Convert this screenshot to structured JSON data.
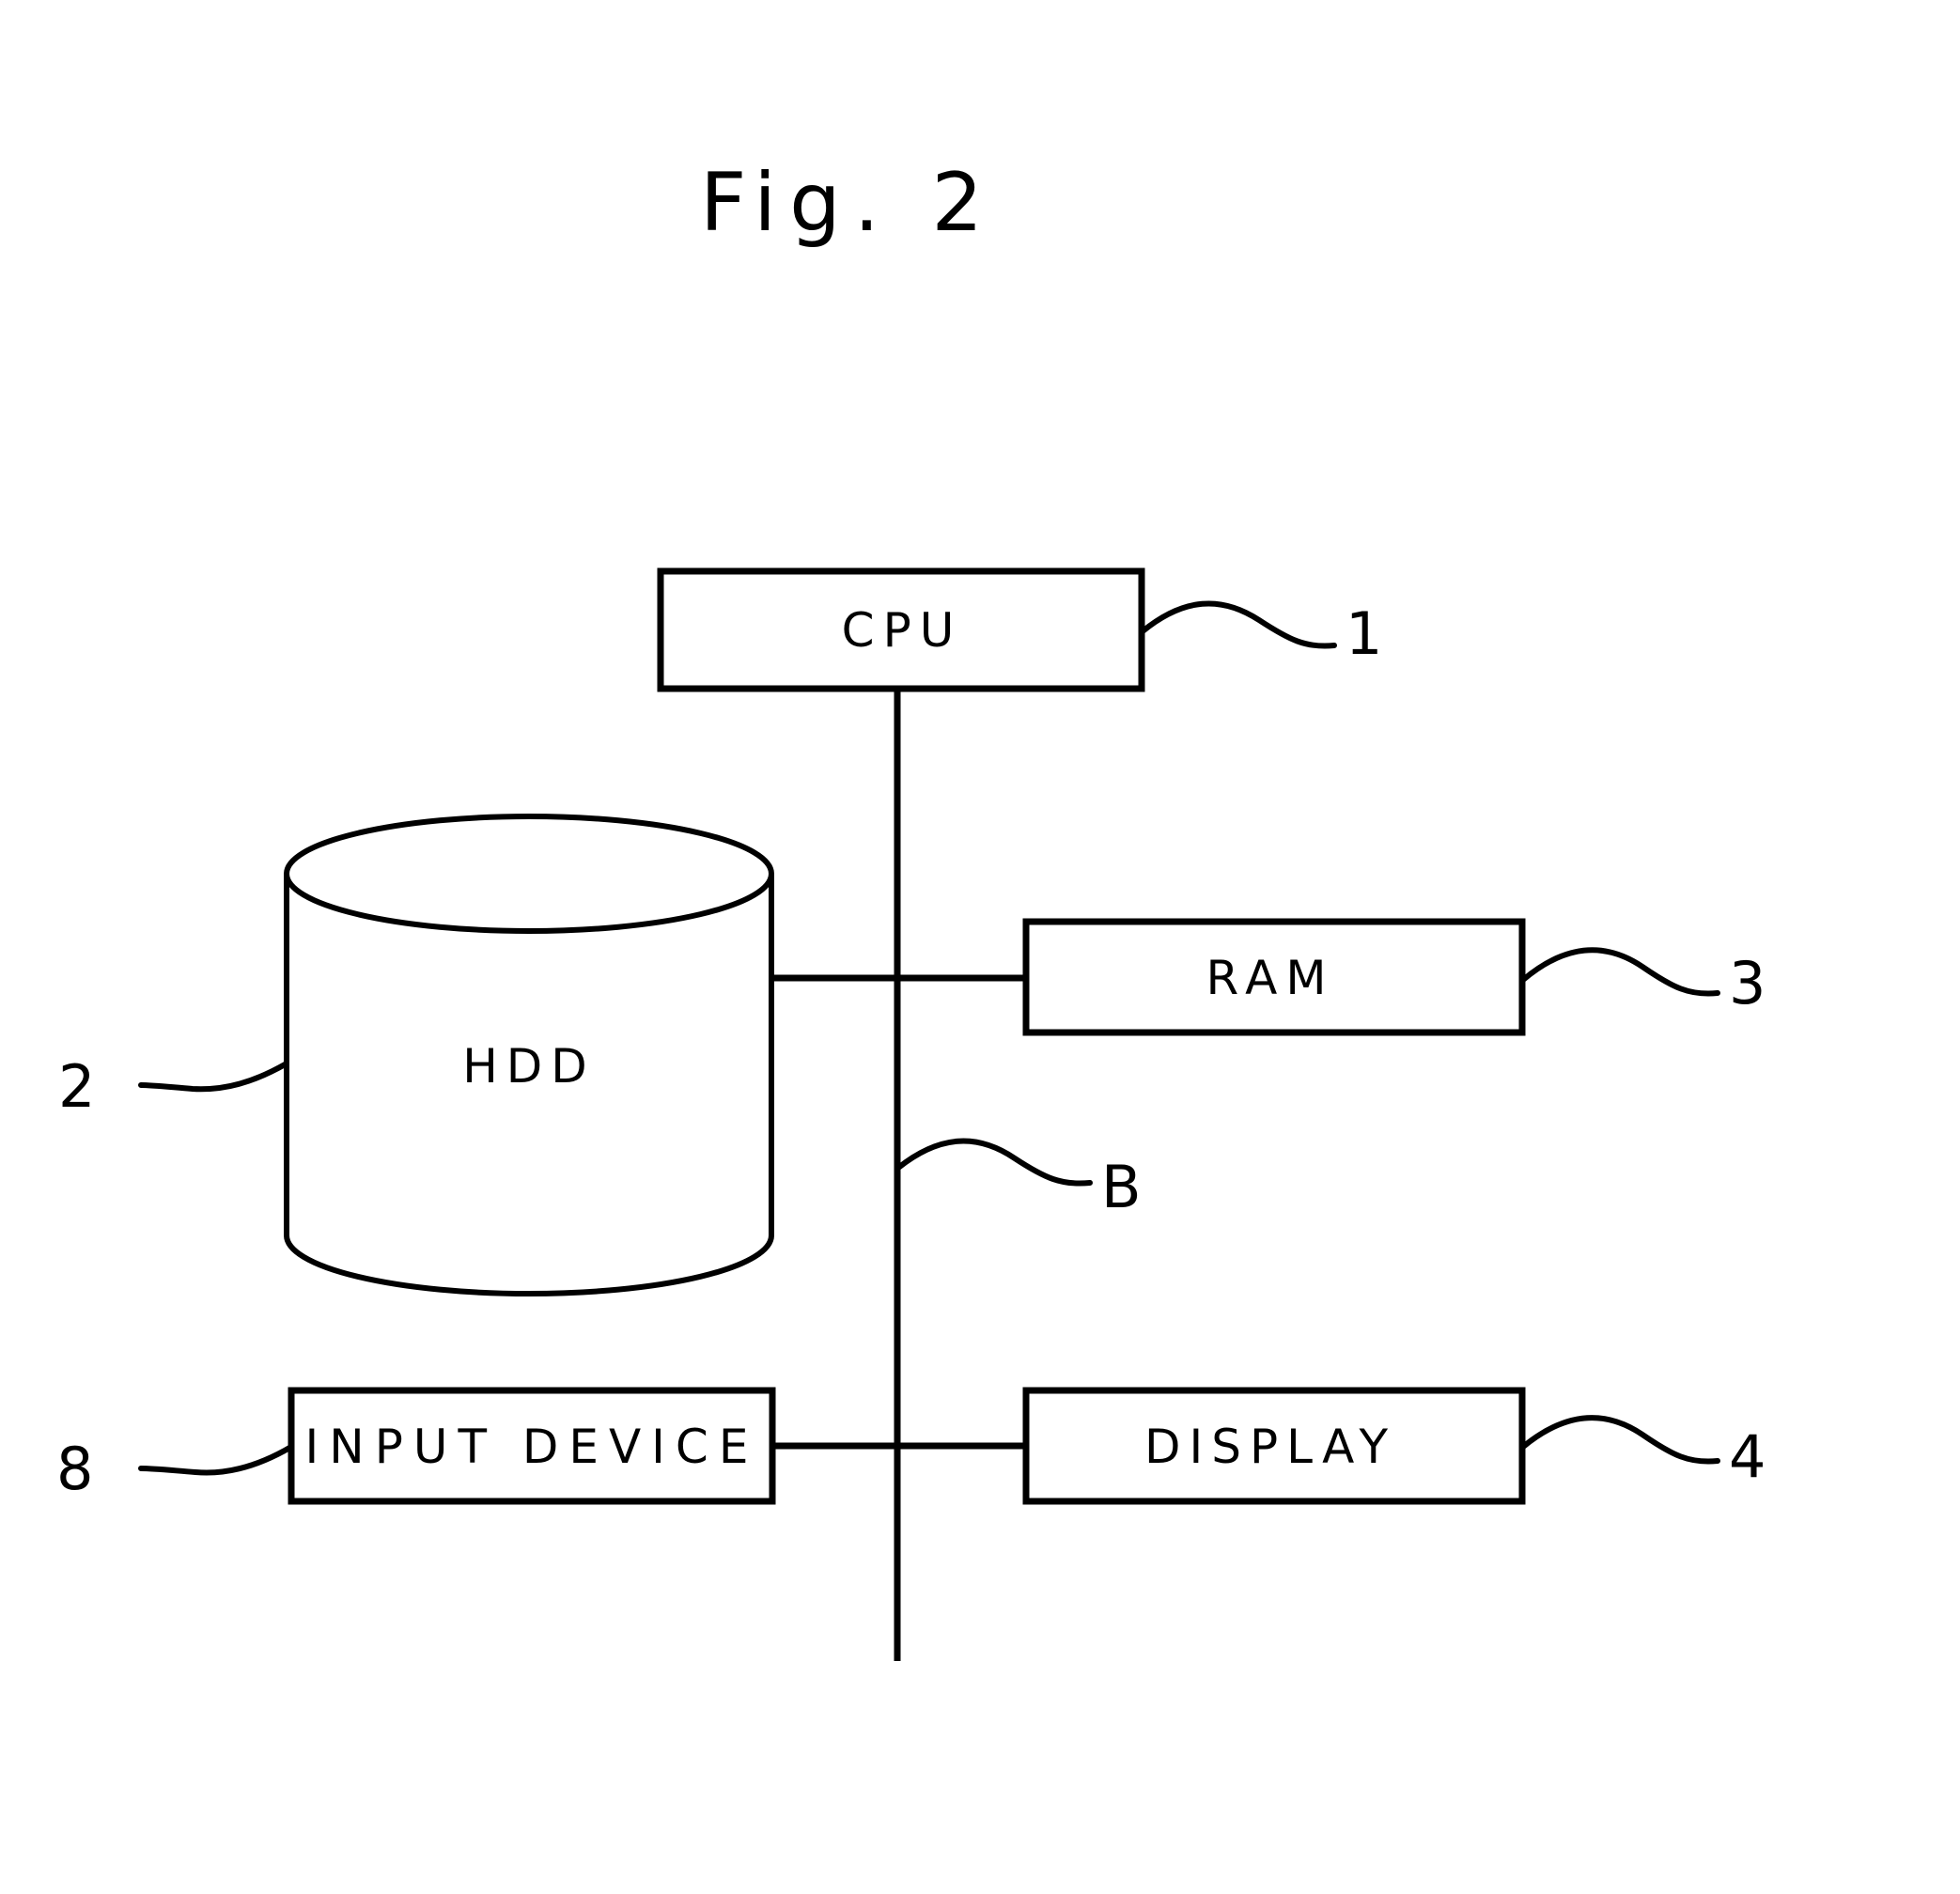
{
  "figure": {
    "title": "Fig. 2",
    "kind": "patent-block-diagram",
    "background_color": "#ffffff",
    "line_color": "#000000"
  },
  "blocks": [
    {
      "id": "cpu",
      "label": "CPU",
      "shape": "rectangle",
      "reference_numeral": "1"
    },
    {
      "id": "hdd",
      "label": "HDD",
      "shape": "cylinder",
      "reference_numeral": "2"
    },
    {
      "id": "ram",
      "label": "RAM",
      "shape": "rectangle",
      "reference_numeral": "3"
    },
    {
      "id": "display",
      "label": "DISPLAY",
      "shape": "rectangle",
      "reference_numeral": "4"
    },
    {
      "id": "input_device",
      "label": "INPUT DEVICE",
      "shape": "rectangle",
      "reference_numeral": "8"
    }
  ],
  "bus": {
    "id": "bus",
    "label": "B",
    "description": "vertical bus line connecting CPU, HDD, RAM, INPUT DEVICE and DISPLAY"
  },
  "reference_numerals": {
    "cpu": "1",
    "hdd": "2",
    "ram": "3",
    "display": "4",
    "input_device": "8",
    "bus": "B"
  }
}
